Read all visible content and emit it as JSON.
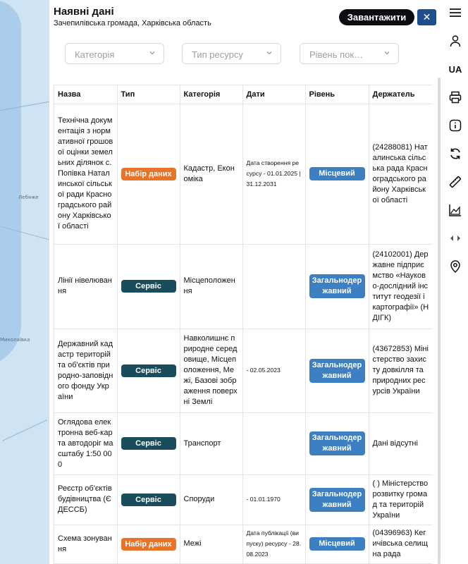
{
  "map": {
    "places": [
      "Лебяже",
      "Миколаївка"
    ]
  },
  "panel": {
    "title": "Наявні дані",
    "subtitle": "Зачепилівська громада, Харківська область",
    "download_label": "Завантажити",
    "close_label": "✕"
  },
  "filters": [
    {
      "placeholder": "Категорія"
    },
    {
      "placeholder": "Тип ресурсу"
    },
    {
      "placeholder": "Рівень пок…"
    }
  ],
  "table": {
    "headers": [
      "Назва",
      "Тип",
      "Категорія",
      "Дати",
      "Рівень",
      "Держатель"
    ],
    "rows": [
      {
        "name": "Технічна документація з нормативної грошової оцінки земельних ділянок с. Попівка Наталинської сільської ради Красноградського району Харківської області",
        "type": "Набір даних",
        "category": "Кадастр, Економіка",
        "dates": "Дата створення ресурсу - 01.01.2025 | 31.12.2031",
        "level": "Місцевий",
        "holder": "(24288081) Наталинська сільська рада Красноградського району Харківської області"
      },
      {
        "name": "Лінії нівелювання",
        "type": "Сервіс",
        "category": "Місцеположення",
        "dates": "",
        "level": "Загальнодержавний",
        "holder": "(24102001) Державне підприємство «Науково-дослідний інститут геодезії і картографії» (НДІГК)"
      },
      {
        "name": "Державний кадастр територій та об'єктів природно-заповідного фонду України",
        "type": "Сервіс",
        "category": "Навколишнє природне середовище, Місцеположення, Межі, Базові зображення поверхні Землі",
        "dates": "- 02.05.2023",
        "level": "Загальнодержавний",
        "holder": "(43672853) Міністерство захисту довкілля та природних ресурсів України"
      },
      {
        "name": "Оглядова електронна веб-карта автодоріг масштабу 1:50 000",
        "type": "Сервіс",
        "category": "Транспорт",
        "dates": "",
        "level": "Загальнодержавний",
        "holder": "Дані відсутні"
      },
      {
        "name": "Реєстр об'єктів будівництва (ЄДЕССБ)",
        "type": "Сервіс",
        "category": "Споруди",
        "dates": "- 01.01.1970",
        "level": "Загальнодержавний",
        "holder": "( ) Міністерство розвитку громад та територій України"
      },
      {
        "name": "Схема зонування",
        "type": "Набір даних",
        "category": "Межі",
        "dates": "Дата публікації (випуску) ресурсу - 28.08.2023",
        "level": "Місцевий",
        "holder": "(04396963) Кегичівська селищна рада"
      }
    ]
  },
  "toolbar": {
    "language": "UA",
    "icons": [
      "menu-icon",
      "user-icon",
      "print-icon",
      "info-icon",
      "refresh-icon",
      "ruler-icon",
      "chart-area-icon",
      "compare-icon",
      "location-pin-icon"
    ]
  },
  "colors": {
    "dataset_badge": "#e8742a",
    "service_badge": "#1a4d5c",
    "level_badge": "#3c7fc3",
    "close_button": "#1e4f8c"
  }
}
